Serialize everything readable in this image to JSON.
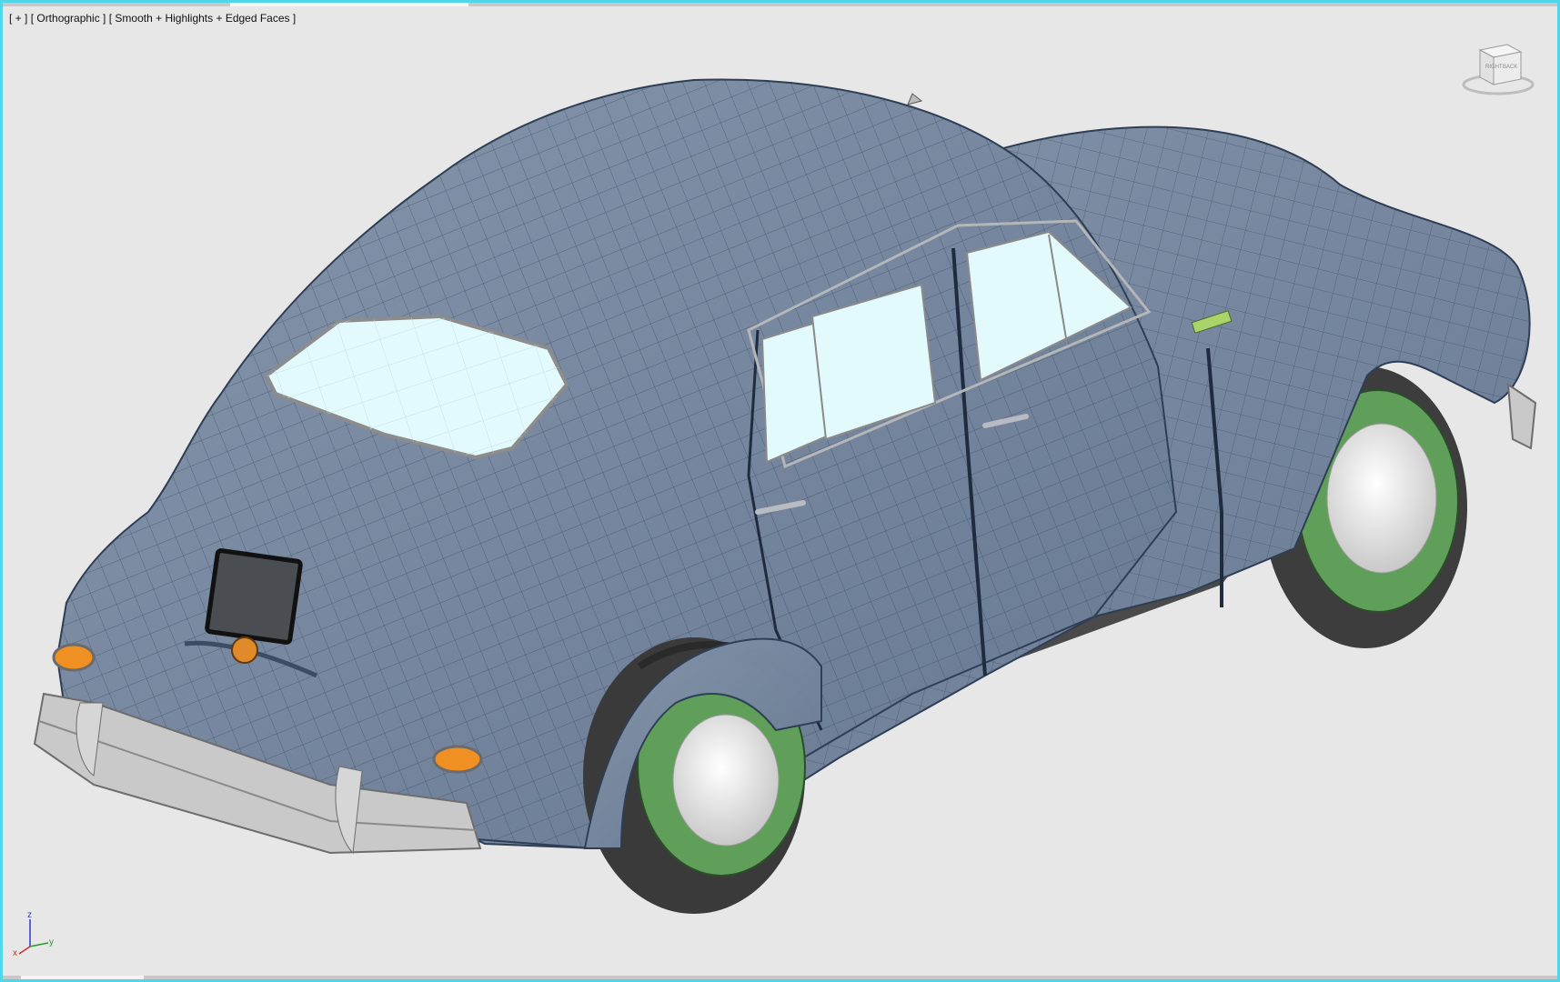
{
  "viewport": {
    "plus_label": "[ + ]",
    "view_label": "[ Orthographic ]",
    "shading_label": "[ Smooth + Highlights + Edged Faces ]"
  },
  "viewcube": {
    "face_right": "RIGHT",
    "face_back": "BACK"
  },
  "axis": {
    "x": "x",
    "y": "y",
    "z": "z"
  },
  "colors": {
    "frame_border": "#4fd6e8",
    "background": "#e7e7e7",
    "body_paint": "#7b8da6",
    "glass": "#dff6fb",
    "rim": "#5a9a55",
    "chrome": "#c8c8c8",
    "tire": "#3a3a3a"
  },
  "icons": {
    "viewcube": "viewcube-icon",
    "axis": "axis-tripod-icon"
  }
}
